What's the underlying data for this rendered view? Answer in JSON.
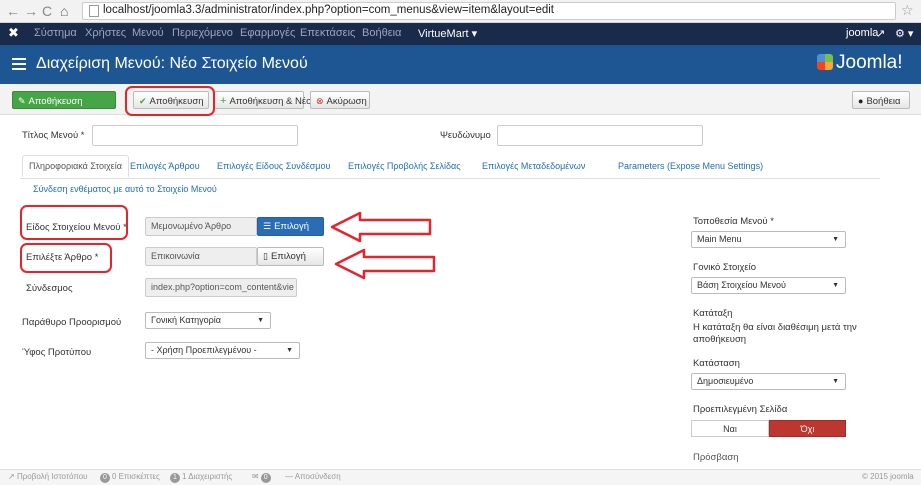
{
  "browser": {
    "url": "localhost/joomla3.3/administrator/index.php?option=com_menus&view=item&layout=edit"
  },
  "topnav": {
    "items": [
      "Σύστημα",
      "Χρήστες",
      "Μενού",
      "Περιεχόμενο",
      "Εφαρμογές",
      "Επεκτάσεις",
      "Βοήθεια"
    ],
    "virtuemart": "VirtueMart ▾",
    "user": "joomla",
    "gear": "⚙ ▾"
  },
  "header": {
    "title": "Διαχείριση Μενού: Νέο Στοιχείο Μενού",
    "logo": "Joomla!"
  },
  "toolbar": {
    "save": "Αποθήκευση",
    "save_close": "Αποθήκευση",
    "save_new": "Αποθήκευση & Νέο",
    "cancel": "Ακύρωση",
    "help": "Βοήθεια"
  },
  "form": {
    "title_label": "Τίτλος Μενού *",
    "alias_label": "Ψευδώνυμο"
  },
  "tabs": [
    "Πληροφοριακά Στοιχεία",
    "Επιλογές Άρθρου",
    "Επιλογές Είδους Συνδέσμου",
    "Επιλογές Προβολής Σελίδας",
    "Επιλογές Μεταδεδομένων",
    "Parameters (Expose Menu Settings)",
    "Σύνδεση ενθέματος με αυτό το Στοιχείο Μενού"
  ],
  "fields": {
    "menu_item_type_label": "Είδος Στοιχείου Μενού *",
    "menu_item_type_value": "Μεμονωμένο Άρθρο",
    "menu_item_type_btn": "Επιλογή",
    "select_article_label": "Επιλέξτε Άρθρο *",
    "select_article_value": "Επικοινωνία",
    "select_article_btn": "Επιλογή",
    "link_label": "Σύνδεσμος",
    "link_value": "index.php?option=com_content&vie",
    "target_label": "Παράθυρο Προορισμού",
    "target_value": "Γονική Κατηγορία",
    "style_label": "Ύφος Προτύπου",
    "style_value": "- Χρήση Προεπιλεγμένου -"
  },
  "right": {
    "location_label": "Τοποθεσία Μενού *",
    "location_value": "Main Menu",
    "parent_label": "Γονικό Στοιχείο",
    "parent_value": "Βάση Στοιχείου Μενού",
    "order_label": "Κατάταξη",
    "order_note": "Η κατάταξη θα είναι διαθέσιμη μετά την αποθήκευση",
    "status_label": "Κατάσταση",
    "status_value": "Δημοσιευμένο",
    "default_label": "Προεπιλεγμένη Σελίδα",
    "yes": "Ναι",
    "no": "Όχι",
    "access_label": "Πρόσβαση"
  },
  "statusbar": {
    "view_site": "Προβολή Ιστοτόπου",
    "visitors_count": "0",
    "visitors": "0 Επισκέπτες",
    "admins_count": "1",
    "admins": "1 Διαχειριστής",
    "messages_count": "0",
    "logout": "— Αποσύνδεση",
    "copyright": "© 2015 joomla"
  },
  "colors": {
    "header": "#1e5593",
    "topnav": "#1a2a4a",
    "save_green": "#46a546",
    "select_blue": "#2a6db5",
    "annotation_red": "#e8232a",
    "toggle_no": "#bd362f"
  }
}
